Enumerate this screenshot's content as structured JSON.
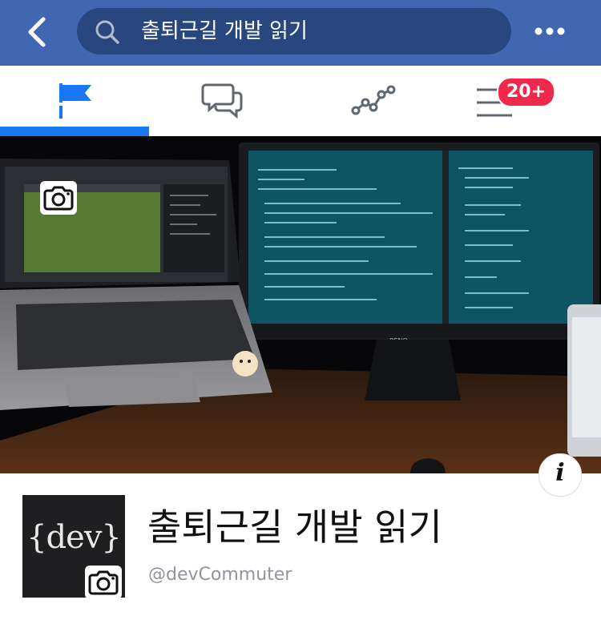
{
  "header": {
    "search_query": "출퇴근길 개발 읽기",
    "icons": [
      "chevron-left-icon",
      "search-icon",
      "more-dots-icon"
    ],
    "bar_color": "#4267b2"
  },
  "tabs": [
    {
      "name": "page-flag",
      "icon": "flag-icon",
      "active": true
    },
    {
      "name": "messages",
      "icon": "chat-bubbles-icon",
      "active": false
    },
    {
      "name": "insights",
      "icon": "insights-graph-icon",
      "active": false
    },
    {
      "name": "menu",
      "icon": "menu-icon",
      "active": false,
      "badge": "20+"
    }
  ],
  "cover": {
    "image": "laptop-and-monitor-code-desk-photo",
    "monitor_brand": "BENQ",
    "camera_icon": "camera-icon",
    "info_icon": "info-icon",
    "info_label": "i"
  },
  "profile": {
    "avatar_text": "{dev}",
    "page_name": "출퇴근길 개발 읽기",
    "handle": "@devCommuter"
  },
  "colors": {
    "accent": "#1877f2",
    "badge": "#f02849",
    "search_bg": "#28477e"
  }
}
